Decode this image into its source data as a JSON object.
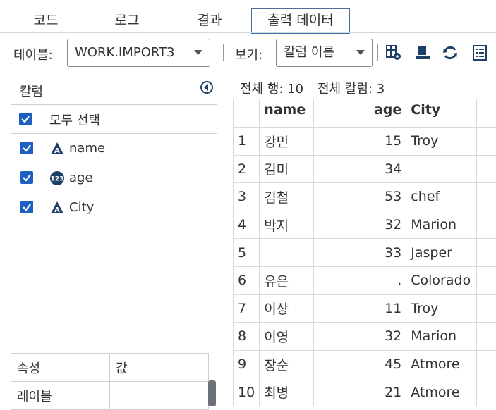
{
  "tabs": [
    {
      "label": "코드"
    },
    {
      "label": "로그"
    },
    {
      "label": "결과"
    },
    {
      "label": "출력 데이터"
    }
  ],
  "toolbar": {
    "table_label": "테이블:",
    "table_value": "WORK.IMPORT3",
    "view_label": "보기:",
    "view_value": "칼럼 이름",
    "icons": [
      "table-settings-icon",
      "column-view-icon",
      "refresh-icon",
      "list-icon"
    ]
  },
  "columns_panel": {
    "title": "칼럼",
    "select_all": "모두 선택",
    "items": [
      {
        "name": "name",
        "type": "character"
      },
      {
        "name": "age",
        "type": "numeric"
      },
      {
        "name": "City",
        "type": "character"
      }
    ]
  },
  "properties": {
    "header_name": "속성",
    "header_value": "값",
    "rows": [
      {
        "name": "레이블",
        "value": ""
      }
    ]
  },
  "grid": {
    "summary_rows": "전체 행: 10",
    "summary_cols": "전체 칼럼: 3",
    "headers": [
      "",
      "name",
      "age",
      "City"
    ],
    "rows": [
      [
        "1",
        "강민",
        "15",
        "Troy"
      ],
      [
        "2",
        "김미",
        "34",
        ""
      ],
      [
        "3",
        "김철",
        "53",
        "chef"
      ],
      [
        "4",
        "박지",
        "32",
        "Marion"
      ],
      [
        "5",
        "",
        "33",
        "Jasper"
      ],
      [
        "6",
        "유은",
        ".",
        "Colorado"
      ],
      [
        "7",
        "이상",
        "11",
        "Troy"
      ],
      [
        "8",
        "이영",
        "32",
        "Marion"
      ],
      [
        "9",
        "장순",
        "45",
        "Atmore"
      ],
      [
        "10",
        "최병",
        "21",
        "Atmore"
      ]
    ]
  },
  "colors": {
    "accent": "#1f5fbf",
    "type_icon": "#1e3f66"
  }
}
